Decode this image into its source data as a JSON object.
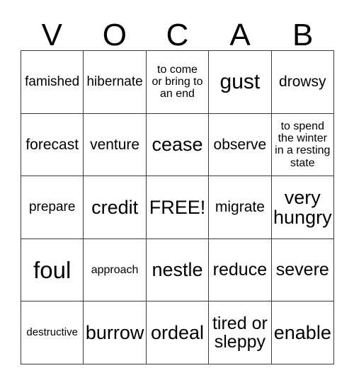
{
  "card": {
    "title_letters": [
      "V",
      "O",
      "C",
      "A",
      "B"
    ],
    "columns": 5,
    "rows": 5,
    "colors": {
      "background": "#ffffff",
      "text": "#000000",
      "grid_line": "#3a3a3a"
    },
    "free_space": {
      "label": "FREE!",
      "row": 3,
      "column": 3
    },
    "cells": [
      {
        "text": "famished",
        "size": "fs-md"
      },
      {
        "text": "hibernate",
        "size": "fs-md"
      },
      {
        "text": "to come\nor bring to\nan end",
        "size": "fs-sm"
      },
      {
        "text": "gust",
        "size": "fs-3xl"
      },
      {
        "text": "drowsy",
        "size": "fs-lg"
      },
      {
        "text": "forecast",
        "size": "fs-lg"
      },
      {
        "text": "venture",
        "size": "fs-lg"
      },
      {
        "text": "cease",
        "size": "fs-2xl"
      },
      {
        "text": "observe",
        "size": "fs-lg"
      },
      {
        "text": "to spend\nthe winter\nin a resting\nstate",
        "size": "fs-sm"
      },
      {
        "text": "prepare",
        "size": "fs-md"
      },
      {
        "text": "credit",
        "size": "fs-2xl"
      },
      {
        "text": "FREE!",
        "size": "fs-2xl"
      },
      {
        "text": "migrate",
        "size": "fs-lg"
      },
      {
        "text": "very\nhungry",
        "size": "fs-2xl"
      },
      {
        "text": "foul",
        "size": "fs-4xl"
      },
      {
        "text": "approach",
        "size": "fs-sm"
      },
      {
        "text": "nestle",
        "size": "fs-2xl"
      },
      {
        "text": "reduce",
        "size": "fs-xl"
      },
      {
        "text": "severe",
        "size": "fs-xl"
      },
      {
        "text": "destructive",
        "size": "fs-xs"
      },
      {
        "text": "burrow",
        "size": "fs-2xl"
      },
      {
        "text": "ordeal",
        "size": "fs-2xl"
      },
      {
        "text": "tired or\nsleppy",
        "size": "fs-xl"
      },
      {
        "text": "enable",
        "size": "fs-2xl"
      }
    ]
  }
}
